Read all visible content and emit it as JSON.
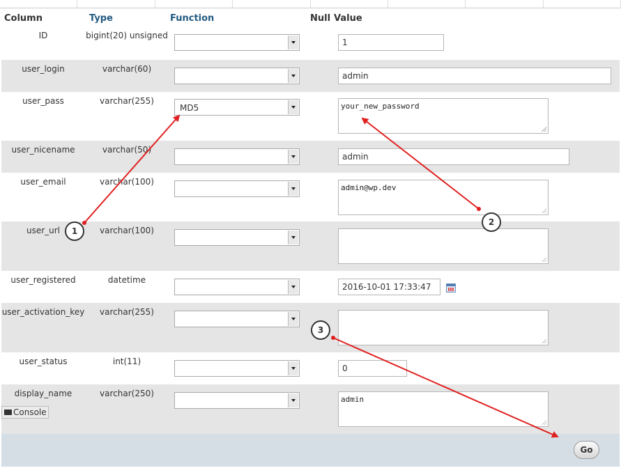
{
  "header": {
    "column": "Column",
    "type": "Type",
    "function": "Function",
    "null": "Null",
    "value": "Value"
  },
  "rows": [
    {
      "name": "ID",
      "type": "bigint(20) unsigned",
      "function": "",
      "value": "1"
    },
    {
      "name": "user_login",
      "type": "varchar(60)",
      "function": "",
      "value": "admin"
    },
    {
      "name": "user_pass",
      "type": "varchar(255)",
      "function": "MD5",
      "value": "your_new_password"
    },
    {
      "name": "user_nicename",
      "type": "varchar(50)",
      "function": "",
      "value": "admin"
    },
    {
      "name": "user_email",
      "type": "varchar(100)",
      "function": "",
      "value": "admin@wp.dev"
    },
    {
      "name": "user_url",
      "type": "varchar(100)",
      "function": "",
      "value": ""
    },
    {
      "name": "user_registered",
      "type": "datetime",
      "function": "",
      "value": "2016-10-01 17:33:47"
    },
    {
      "name": "user_activation_key",
      "type": "varchar(255)",
      "function": "",
      "value": ""
    },
    {
      "name": "user_status",
      "type": "int(11)",
      "function": "",
      "value": "0"
    },
    {
      "name": "display_name",
      "type": "varchar(250)",
      "function": "",
      "value": "admin"
    }
  ],
  "console_label": "Console",
  "go_label": "Go",
  "callouts": [
    "1",
    "2",
    "3"
  ],
  "icons": {
    "dropdown": "chevron-down-icon",
    "calendar": "calendar-icon",
    "console": "console-icon"
  },
  "colors": {
    "arrow": "#e02020",
    "header_link": "#235a81",
    "row_alt": "#e5e5e5",
    "footer": "#d5dde5"
  }
}
